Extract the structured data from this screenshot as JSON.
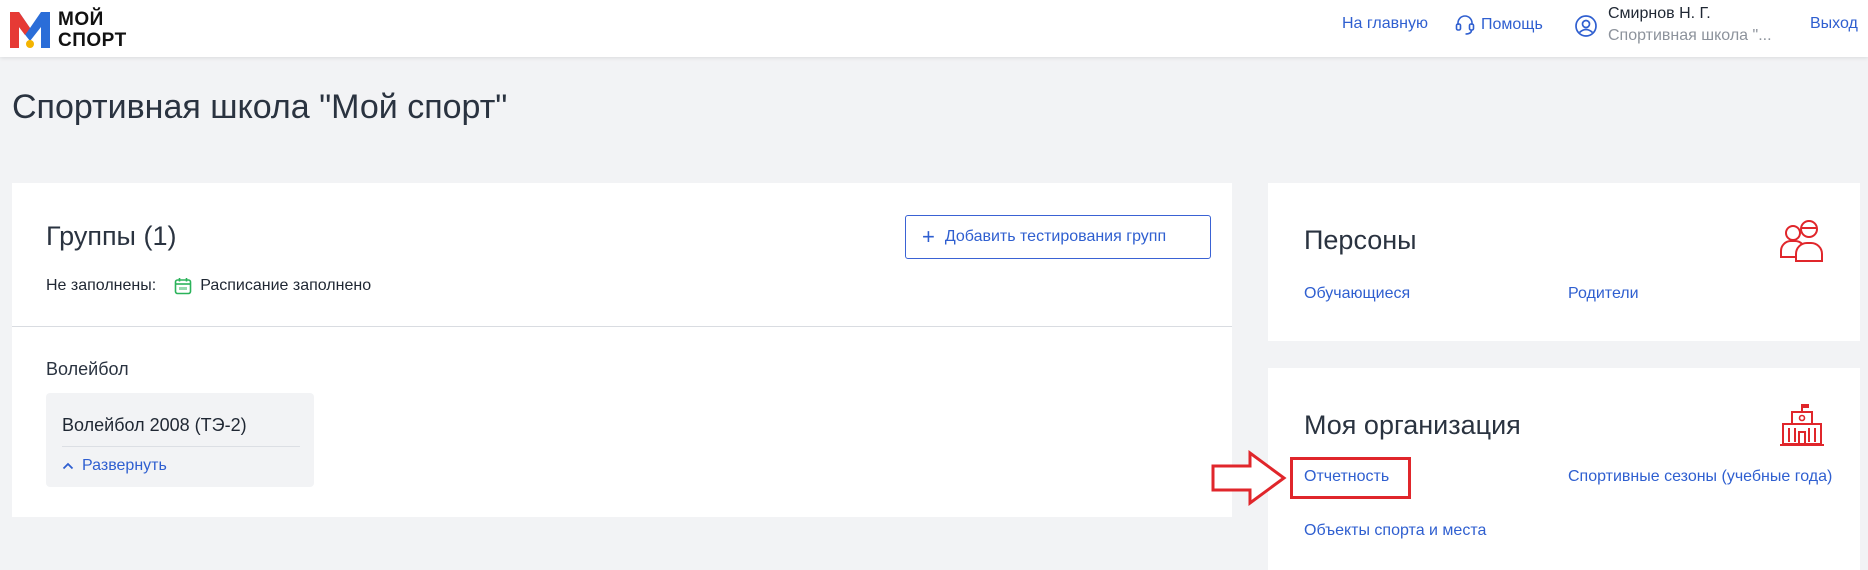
{
  "header": {
    "logo_line1": "МОЙ",
    "logo_line2": "СПОРТ",
    "home_link": "На главную",
    "help_link": "Помощь",
    "user_name": "Смирнов Н. Г.",
    "user_org": "Спортивная школа \"...",
    "logout": "Выход"
  },
  "page": {
    "title": "Спортивная школа \"Мой спорт\""
  },
  "groups_card": {
    "title": "Группы (1)",
    "add_button": "Добавить тестирования групп",
    "not_filled_label": "Не заполнены:",
    "schedule_status": "Расписание заполнено",
    "sport": "Волейбол",
    "group": {
      "name": "Волейбол 2008 (ТЭ-2)",
      "expand": "Развернуть"
    }
  },
  "persons_card": {
    "title": "Персоны",
    "links": [
      "Обучающиеся",
      "Родители"
    ]
  },
  "org_card": {
    "title": "Моя организация",
    "links": [
      "Отчетность",
      "Спортивные сезоны (учебные года)",
      "Объекты спорта и места"
    ]
  },
  "icons": {
    "help": "headset-icon",
    "user": "user-circle-icon",
    "plus": "plus-icon",
    "calendar": "calendar-icon",
    "expand": "chevron-up-icon",
    "persons": "people-icon",
    "org": "building-icon",
    "annotation_arrow": "arrow-right-icon"
  },
  "colors": {
    "link": "#2f5fd0",
    "accent_red": "#e0262b",
    "calendar_green": "#2bb35a",
    "background": "#f2f3f5"
  }
}
